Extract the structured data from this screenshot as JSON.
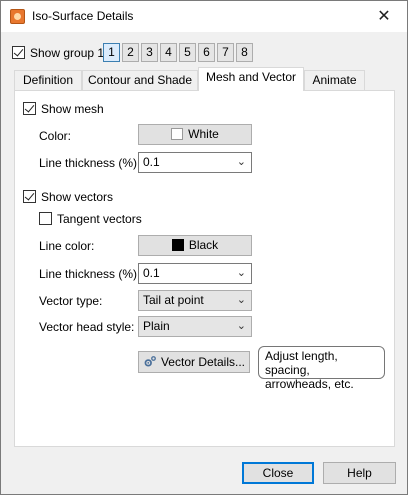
{
  "window": {
    "title": "Iso-Surface Details",
    "close_glyph": "✕"
  },
  "show_group": {
    "label": "Show group 1",
    "checked": true,
    "buttons": [
      "1",
      "2",
      "3",
      "4",
      "5",
      "6",
      "7",
      "8"
    ],
    "active": "1"
  },
  "tabs": [
    {
      "label": "Definition",
      "active": false
    },
    {
      "label": "Contour and Shade",
      "active": false
    },
    {
      "label": "Mesh and Vector",
      "active": true
    },
    {
      "label": "Animate",
      "active": false
    }
  ],
  "mesh": {
    "show_label": "Show mesh",
    "show_checked": true,
    "color_label": "Color:",
    "color_value": "White",
    "color_swatch": "#ffffff",
    "thickness_label": "Line thickness (%):",
    "thickness_value": "0.1"
  },
  "vectors": {
    "show_label": "Show vectors",
    "show_checked": true,
    "tangent_label": "Tangent vectors",
    "tangent_checked": false,
    "line_color_label": "Line color:",
    "line_color_value": "Black",
    "line_color_swatch": "#000000",
    "thickness_label": "Line thickness (%):",
    "thickness_value": "0.1",
    "type_label": "Vector type:",
    "type_value": "Tail at point",
    "head_style_label": "Vector head style:",
    "head_style_value": "Plain",
    "details_button": "Vector Details...",
    "tooltip_line1": "Adjust length, spacing,",
    "tooltip_line2": "arrowheads, etc."
  },
  "footer": {
    "close_label": "Close",
    "help_label": "Help"
  },
  "icons": {
    "app": "iso-surface-app-icon",
    "gear": "gear-icon",
    "chevron": "chevron-down-icon"
  },
  "colors": {
    "accent": "#0078d7",
    "active_group": "#dcecfc",
    "app_icon": "#e8772e"
  }
}
